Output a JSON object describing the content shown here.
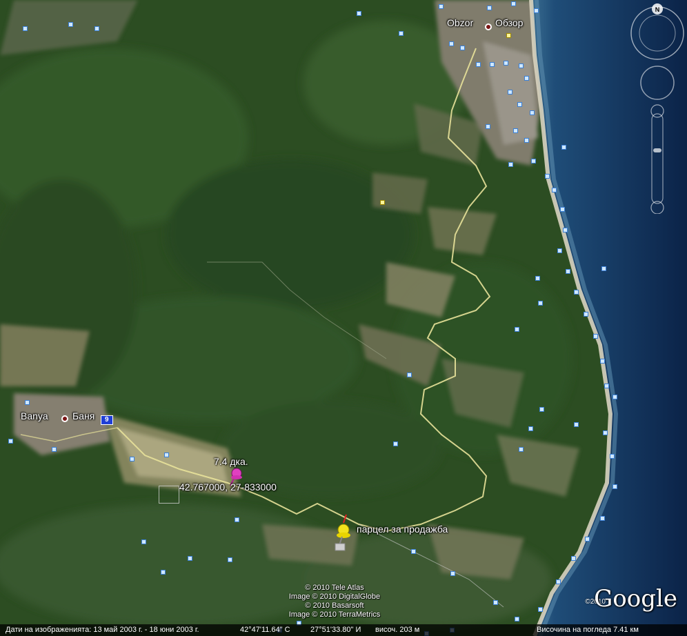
{
  "map": {
    "places": [
      {
        "id": "obzor",
        "name": "Obzor • Обзор",
        "latin": "Obzor",
        "cyrillic": "Обзор"
      },
      {
        "id": "banya",
        "name": "Banya • Баня",
        "latin": "Banya",
        "cyrillic": "Баня"
      }
    ],
    "route_badge": "9",
    "placemarks": [
      {
        "id": "pink",
        "label_line1": "7.4 дка.",
        "label_line2": "42.767000, 27-833000",
        "color": "#e040c0"
      },
      {
        "id": "yellow",
        "label_line1": "парцел за продажба",
        "color": "#f2e21c"
      }
    ],
    "colors": {
      "sea_deep": "#0d2a52",
      "sea_shallow": "#2d5f8a",
      "forest": "#2f5224",
      "field": "#8b8a64",
      "road": "#e8e29a",
      "beach": "#d8d3bf"
    }
  },
  "copyright": {
    "lines": [
      "© 2010 Tele Atlas",
      "Image © 2010 DigitalGlobe",
      "© 2010 Basarsoft",
      "Image © 2010 TerraMetrics"
    ],
    "logo": "Google",
    "logo_year": "©2010"
  },
  "nav": {
    "north": "N"
  },
  "status_bar": {
    "imagery_dates": "Дати на изображенията: 13 май 2003 г. - 18 юни 2003 г.",
    "lat": "42°47'11.64\" С",
    "lon": "27°51'33.80\" И",
    "elevation": "височ.  203 м",
    "eye_alt": "Височина на погледа    7.41 км"
  }
}
